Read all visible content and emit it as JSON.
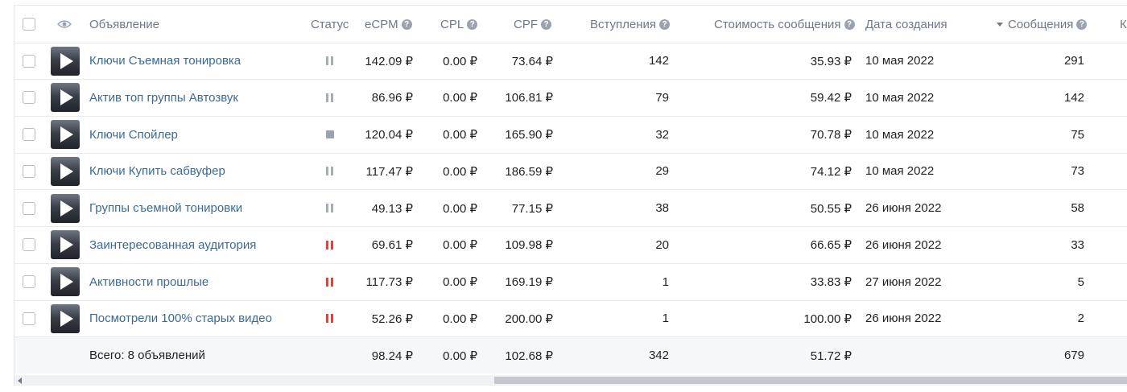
{
  "header": {
    "ad": "Объявление",
    "status": "Статус",
    "ecpm": "eCPM",
    "cpl": "CPL",
    "cpf": "CPF",
    "joins": "Вступления",
    "msg_cost": "Стоимость сообщения",
    "created": "Дата создания",
    "messages": "Сообщения",
    "next": "К",
    "help_glyph": "?",
    "visibility_icon": "eye-icon",
    "sort_icon": "caret-down-icon"
  },
  "rows": [
    {
      "name": "Ключи Съемная тонировка",
      "status": "paused",
      "ecpm": "142.09 ₽",
      "cpl": "0.00 ₽",
      "cpf": "73.64 ₽",
      "joins": "142",
      "msg_cost": "35.93 ₽",
      "created": "10 мая 2022",
      "messages": "291"
    },
    {
      "name": "Актив топ группы Автозвук",
      "status": "paused",
      "ecpm": "86.96 ₽",
      "cpl": "0.00 ₽",
      "cpf": "106.81 ₽",
      "joins": "79",
      "msg_cost": "59.42 ₽",
      "created": "10 мая 2022",
      "messages": "142"
    },
    {
      "name": "Ключи Спойлер",
      "status": "stopped",
      "ecpm": "120.04 ₽",
      "cpl": "0.00 ₽",
      "cpf": "165.90 ₽",
      "joins": "32",
      "msg_cost": "70.78 ₽",
      "created": "10 мая 2022",
      "messages": "75"
    },
    {
      "name": "Ключи Купить сабвуфер",
      "status": "paused",
      "ecpm": "117.47 ₽",
      "cpl": "0.00 ₽",
      "cpf": "186.59 ₽",
      "joins": "29",
      "msg_cost": "74.12 ₽",
      "created": "10 мая 2022",
      "messages": "73"
    },
    {
      "name": "Группы съемной тонировки",
      "status": "paused",
      "ecpm": "49.13 ₽",
      "cpl": "0.00 ₽",
      "cpf": "77.15 ₽",
      "joins": "38",
      "msg_cost": "50.55 ₽",
      "created": "26 июня 2022",
      "messages": "58"
    },
    {
      "name": "Заинтересованная аудитория",
      "status": "paused-red",
      "ecpm": "69.61 ₽",
      "cpl": "0.00 ₽",
      "cpf": "109.98 ₽",
      "joins": "20",
      "msg_cost": "66.65 ₽",
      "created": "26 июня 2022",
      "messages": "33"
    },
    {
      "name": "Активности прошлые",
      "status": "paused-red",
      "ecpm": "117.73 ₽",
      "cpl": "0.00 ₽",
      "cpf": "169.19 ₽",
      "joins": "1",
      "msg_cost": "33.83 ₽",
      "created": "27 июня 2022",
      "messages": "5"
    },
    {
      "name": "Посмотрели 100% старых видео",
      "status": "paused-red",
      "ecpm": "52.26 ₽",
      "cpl": "0.00 ₽",
      "cpf": "200.00 ₽",
      "joins": "1",
      "msg_cost": "100.00 ₽",
      "created": "26 июня 2022",
      "messages": "2"
    }
  ],
  "footer": {
    "label": "Всего: 8 объявлений",
    "ecpm": "98.24 ₽",
    "cpl": "0.00 ₽",
    "cpf": "102.68 ₽",
    "joins": "342",
    "msg_cost": "51.72 ₽",
    "messages": "679"
  },
  "colors": {
    "link": "#3d6a94",
    "paused_gray": "#a5adb7",
    "paused_red": "#e0433a",
    "header_text": "#6f7985"
  }
}
